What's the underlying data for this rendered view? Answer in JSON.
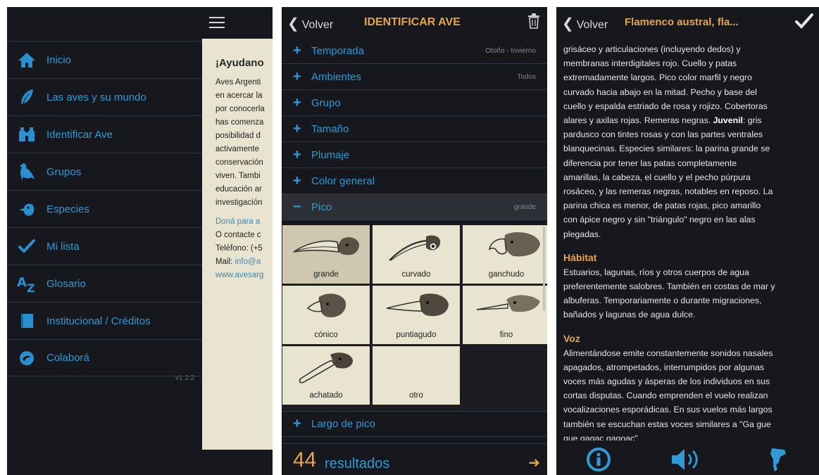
{
  "screen1": {
    "menu": [
      {
        "label": "Inicio",
        "icon": "home-icon"
      },
      {
        "label": "Las aves y su mundo",
        "icon": "feather-icon"
      },
      {
        "label": "Identificar Ave",
        "icon": "binoculars-icon"
      },
      {
        "label": "Grupos",
        "icon": "bird-icon"
      },
      {
        "label": "Especies",
        "icon": "bird-head-icon"
      },
      {
        "label": "Mi lista",
        "icon": "checkmark-icon"
      },
      {
        "label": "Glosario",
        "icon": "az-icon"
      },
      {
        "label": "Institucional / Créditos",
        "icon": "book-icon"
      },
      {
        "label": "Colaborá",
        "icon": "hand-icon"
      }
    ],
    "version": "v1.2.2",
    "content": {
      "title": "¡Ayudano",
      "lines": [
        "Aves Argenti",
        "en acercar la",
        "por conocerla",
        "has comenza",
        "posibilidad d",
        "activamente",
        "conservación",
        "viven. Tambi",
        "educación ar",
        "investigación"
      ],
      "donate": "Doná para a",
      "contact_lines": [
        "O contacte c",
        "Teléfono: (+5"
      ],
      "mail_label": "Mail: ",
      "mail_value": "info@a",
      "web": "www.avesarg"
    }
  },
  "screen2": {
    "back_label": "Volver",
    "title": "IDENTIFICAR AVE",
    "filters": [
      {
        "sign": "+",
        "label": "Temporada",
        "value": "Otoño - Invierno"
      },
      {
        "sign": "+",
        "label": "Ambientes",
        "value": "Todos"
      },
      {
        "sign": "+",
        "label": "Grupo",
        "value": ""
      },
      {
        "sign": "+",
        "label": "Tamaño",
        "value": ""
      },
      {
        "sign": "+",
        "label": "Plumaje",
        "value": ""
      },
      {
        "sign": "+",
        "label": "Color general",
        "value": ""
      },
      {
        "sign": "−",
        "label": "Pico",
        "value": "grande"
      }
    ],
    "beaks": [
      "grande",
      "curvado",
      "ganchudo",
      "cónico",
      "puntiagudo",
      "fino",
      "achatado",
      "otro"
    ],
    "largo": {
      "sign": "+",
      "label": "Largo de pico"
    },
    "results": {
      "count": "44",
      "label": "resultados",
      "arrow": "➜"
    }
  },
  "screen3": {
    "back_label": "Volver",
    "title": "Flamenco austral, fla...",
    "intro_lines": [
      "grisáceo y articulaciones (incluyendo dedos) y",
      "membranas interdigitales rojo. Cuello y patas",
      "extremadamente largos. Pico color marfil y negro",
      "curvado hacia abajo en la mitad. Pecho y base del",
      "cuello y espalda estriado de rosa y rojizo. Cobertoras",
      "alares y axilas rojas. Remeras negras."
    ],
    "juvenil_label": "Juvenil",
    "juvenil_text": ": gris",
    "juvenil_lines": [
      "pardusco con tintes rosas y con las partes ventrales",
      "blanquecinas. Especies similares: la parina grande se",
      "diferencia por tener las patas completamente",
      "amarillas, la cabeza, el cuello y el pecho púrpura",
      "rosáceo, y las remeras negras, notables en reposo. La",
      "parina chica es menor, de patas rojas, pico amarillo",
      "con ápice negro y sin \"triángulo\" negro en las alas",
      "plegadas."
    ],
    "habitat_head": "Hábitat",
    "habitat_lines": [
      "Estuarios, lagunas, ríos y otros cuerpos de agua",
      "preferentemente salobres. También en costas de mar y",
      "albuferas. Temporariamente o durante migraciones,",
      "bañados y lagunas de agua dulce."
    ],
    "voz_head": "Voz",
    "voz_lines": [
      "Alimentándose emite constantemente sonidos nasales",
      "apagados, atrompetados, interrumpidos por algunas",
      "voces más agudas y ásperas de los individuos en sus",
      "cortas disputas. Cuando emprenden el vuelo realizan",
      "vocalizaciones esporádicas. En sus vuelos más largos",
      "también se escuchan estas voces similares a \"Ga gue",
      "gue gagac gagoac\""
    ],
    "tabs": [
      "info-icon",
      "speaker-icon",
      "map-icon"
    ]
  },
  "colors": {
    "accent_blue": "#2f9ad6",
    "accent_orange": "#e5a54a",
    "background": "#16181d",
    "panel": "#e9e4cf"
  }
}
